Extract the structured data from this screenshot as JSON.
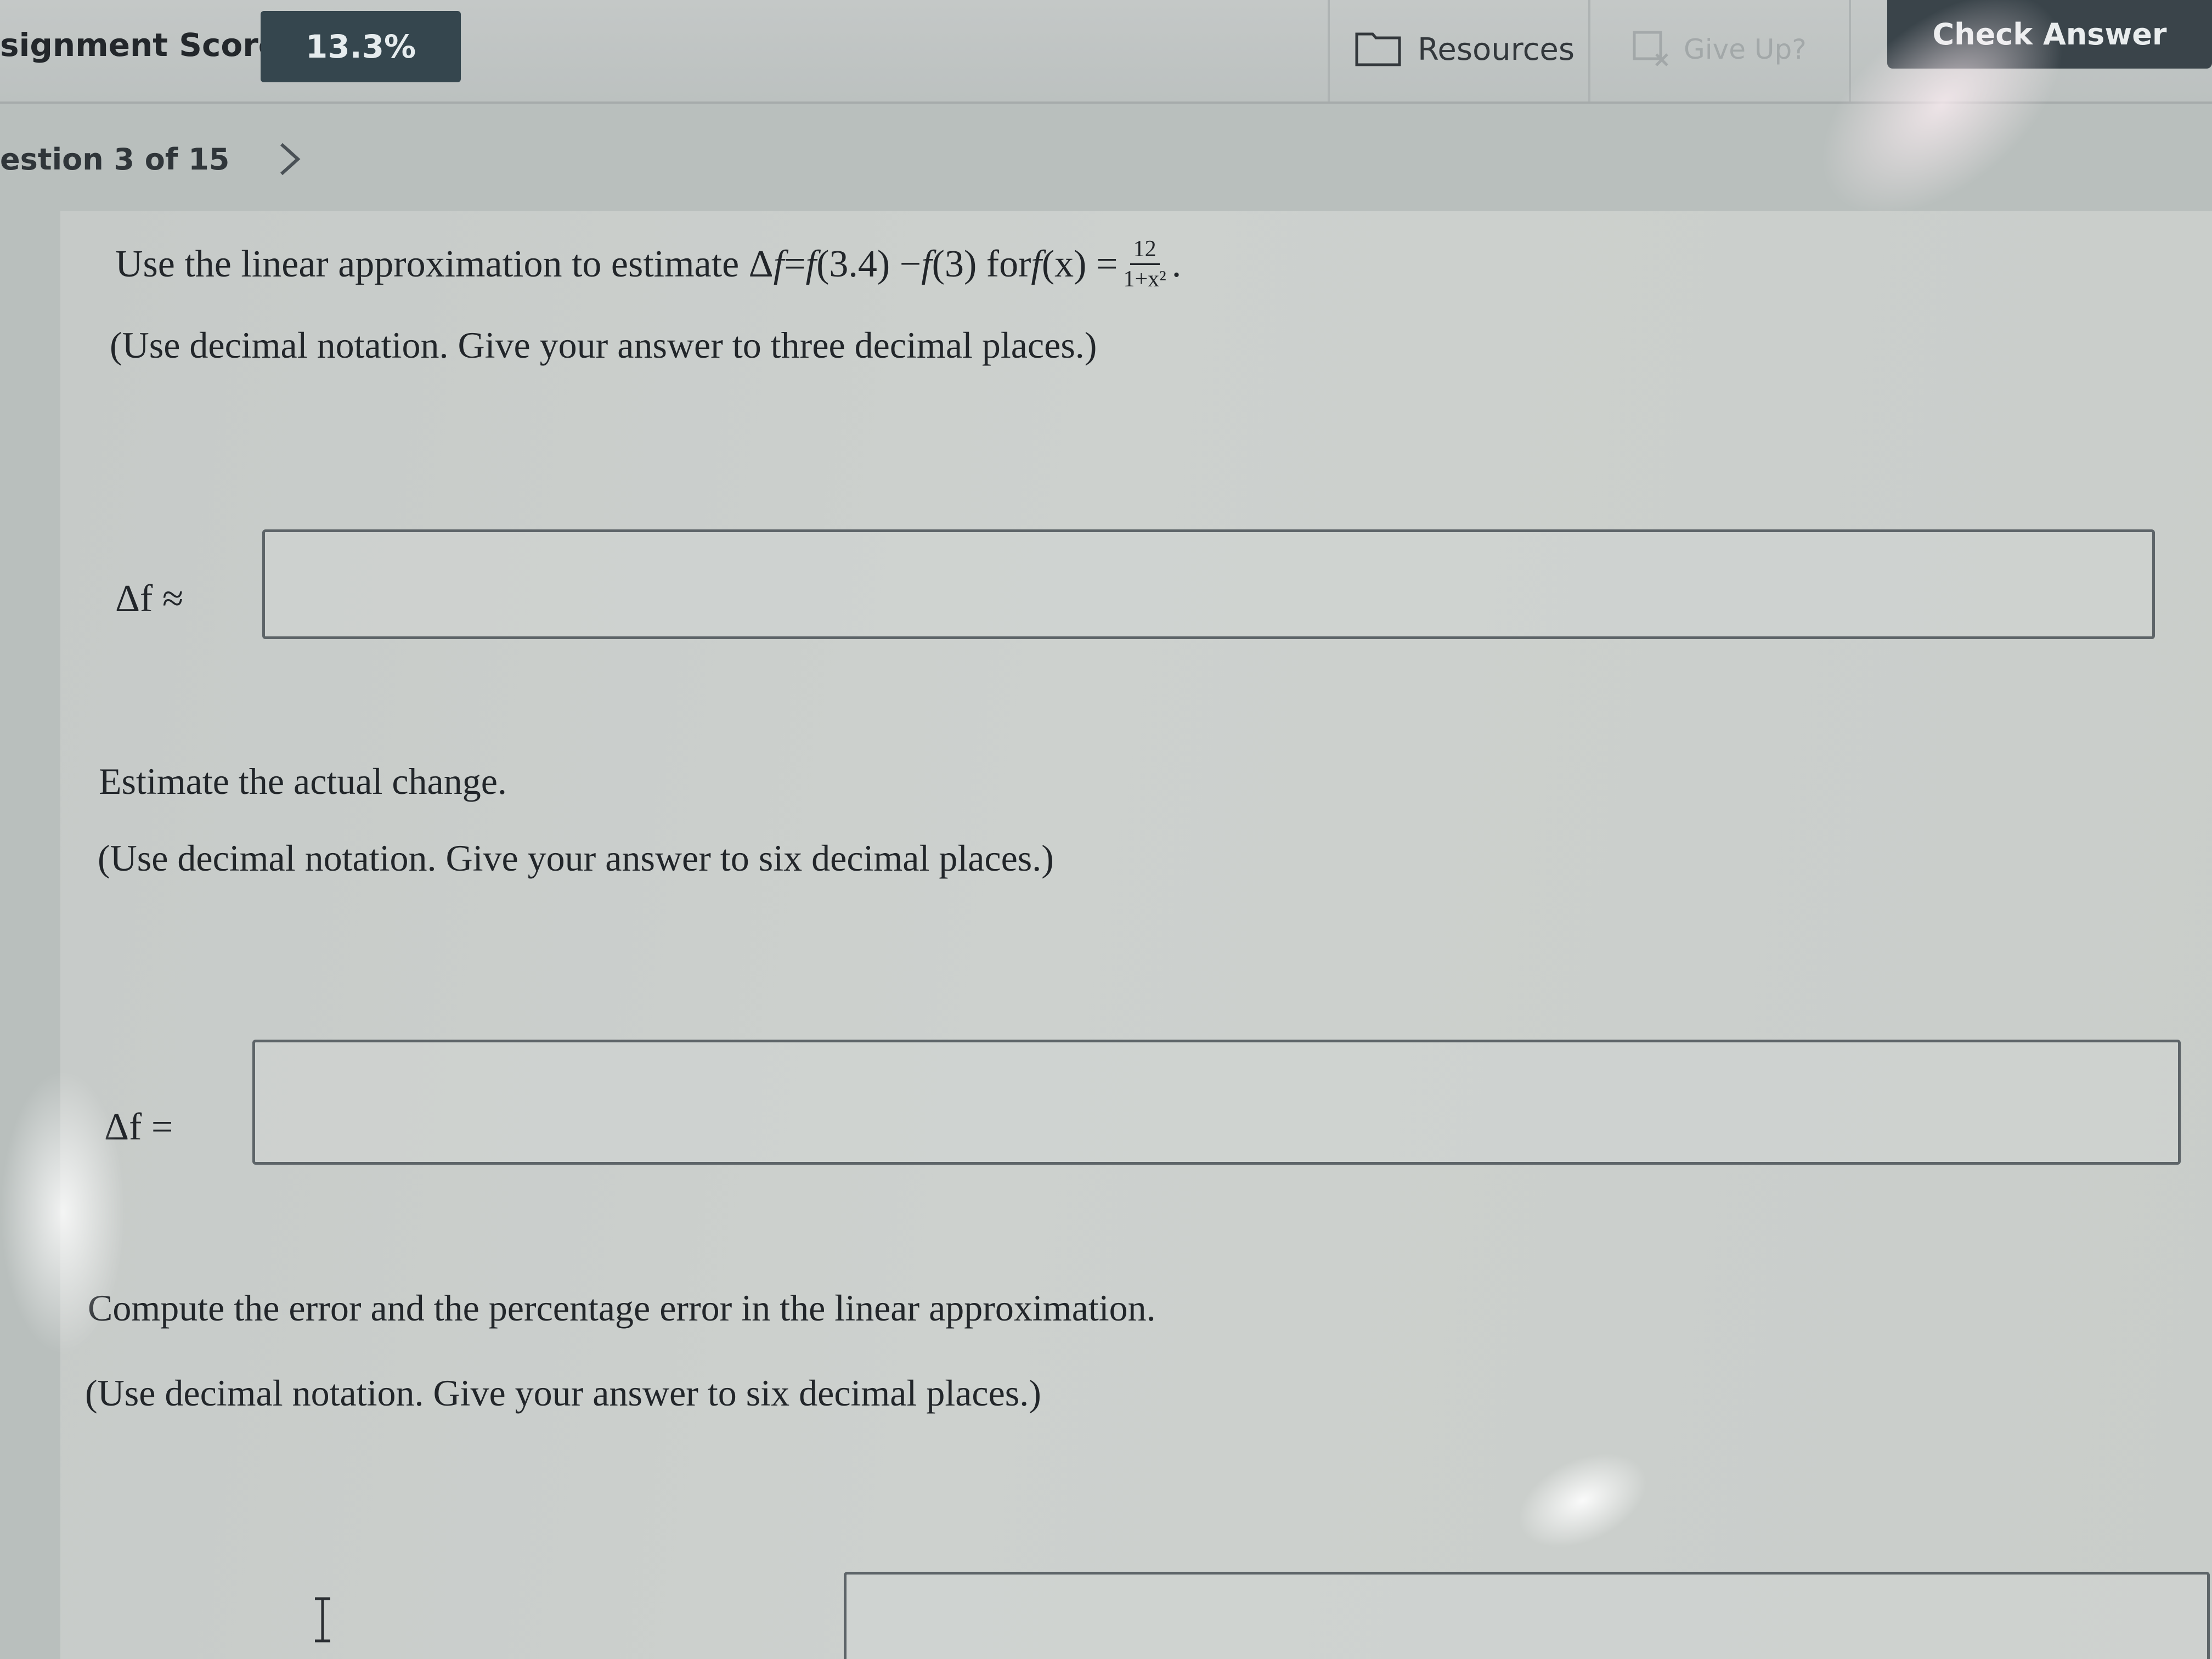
{
  "header": {
    "score_label": "signment Score:",
    "score_value": "13.3%",
    "resources_label": "Resources",
    "give_up_label": "Give Up?",
    "check_answer_label": "Check Answer"
  },
  "nav": {
    "question_label": "estion 3 of 15"
  },
  "question": {
    "prompt_prefix": "Use the linear approximation to estimate Δ",
    "prompt_f": "f",
    "prompt_mid": " = ",
    "prompt_f34": "f",
    "prompt_34": "(3.4) − ",
    "prompt_f3": "f",
    "prompt_3": "(3) for ",
    "prompt_fx": "f",
    "prompt_x": "(x) = ",
    "fraction_num": "12",
    "fraction_den": "1+x²",
    "prompt_end": ".",
    "part1_instruction": "(Use decimal notation. Give your answer to three decimal places.)",
    "part1_lhs": "Δf ≈",
    "part1_value": "",
    "part2_heading": "Estimate the actual change.",
    "part2_instruction": "(Use decimal notation. Give your answer to six decimal places.)",
    "part2_lhs": "Δf =",
    "part2_value": "",
    "part3_heading": "Compute the error and the percentage error in the linear approximation.",
    "part3_instruction": "(Use decimal notation. Give your answer to six decimal places.)",
    "part3_value": ""
  },
  "icons": {
    "resources": "folder-icon",
    "give_up": "give-up-icon",
    "next": "chevron-right-icon",
    "cursor": "text-cursor-icon"
  },
  "colors": {
    "score_badge": "#35464e",
    "check_button": "#3a444a",
    "background": "#b9bfbd"
  }
}
